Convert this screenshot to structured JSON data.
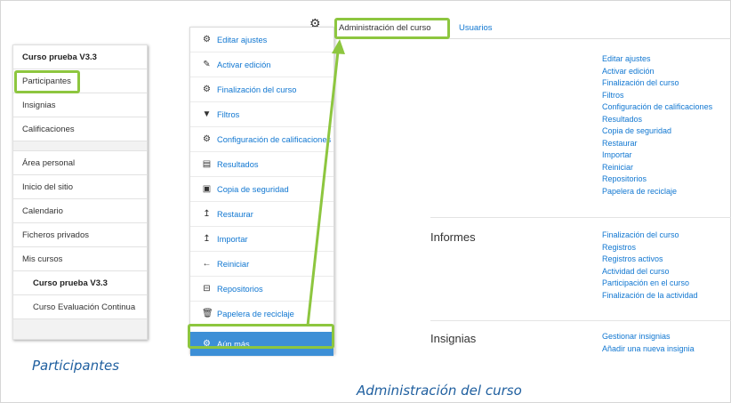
{
  "nav": {
    "items": [
      {
        "label": "Curso prueba V3.3",
        "style": "bold"
      },
      {
        "label": "Participantes",
        "style": "normal"
      },
      {
        "label": "Insignias",
        "style": "normal"
      },
      {
        "label": "Calificaciones",
        "style": "normal"
      },
      {
        "label": "Área personal",
        "style": "normal"
      },
      {
        "label": "Inicio del sitio",
        "style": "normal"
      },
      {
        "label": "Calendario",
        "style": "normal"
      },
      {
        "label": "Ficheros privados",
        "style": "normal"
      },
      {
        "label": "Mis cursos",
        "style": "normal"
      },
      {
        "label": "Curso prueba V3.3",
        "style": "bold-indent"
      },
      {
        "label": "Curso Evaluación Continua",
        "style": "indent"
      }
    ]
  },
  "actions_menu": {
    "gear_icon": "gear-icon",
    "items": [
      {
        "label": "Editar ajustes",
        "icon": "gear-icon",
        "glyph": "⚙"
      },
      {
        "label": "Activar edición",
        "icon": "pencil-icon",
        "glyph": "✎"
      },
      {
        "label": "Finalización del curso",
        "icon": "gear-icon",
        "glyph": "⚙"
      },
      {
        "label": "Filtros",
        "icon": "filter-icon",
        "glyph": "▼"
      },
      {
        "label": "Configuración de calificaciones",
        "icon": "gear-icon",
        "glyph": "⚙"
      },
      {
        "label": "Resultados",
        "icon": "table-icon",
        "glyph": "▤"
      },
      {
        "label": "Copia de seguridad",
        "icon": "file-icon",
        "glyph": "▣"
      },
      {
        "label": "Restaurar",
        "icon": "upload-icon",
        "glyph": "↥"
      },
      {
        "label": "Importar",
        "icon": "upload-icon",
        "glyph": "↥"
      },
      {
        "label": "Reiniciar",
        "icon": "arrow-left-icon",
        "glyph": "←"
      },
      {
        "label": "Repositorios",
        "icon": "drive-icon",
        "glyph": "⊟"
      },
      {
        "label": "Papelera de reciclaje",
        "icon": "trash-icon",
        "glyph": "🗑"
      },
      {
        "label": "Aún más...",
        "icon": "gear-icon",
        "glyph": "⚙"
      }
    ],
    "active_index": 12
  },
  "tabs": {
    "admin": "Administración del curso",
    "users": "Usuarios"
  },
  "main": {
    "course_links": [
      "Editar ajustes",
      "Activar edición",
      "Finalización del curso",
      "Filtros",
      "Configuración de calificaciones",
      "Resultados",
      "Copia de seguridad",
      "Restaurar",
      "Importar",
      "Reiniciar",
      "Repositorios",
      "Papelera de reciclaje"
    ],
    "reports": {
      "heading": "Informes",
      "links": [
        "Finalización del curso",
        "Registros",
        "Registros activos",
        "Actividad del curso",
        "Participación en el curso",
        "Finalización de la actividad"
      ]
    },
    "badges": {
      "heading": "Insignias",
      "links": [
        "Gestionar insignias",
        "Añadir una nueva insignia"
      ]
    }
  },
  "captions": {
    "left": "Participantes",
    "bottom": "Administración del curso"
  },
  "colors": {
    "highlight": "#8dc63f",
    "link": "#1177d1",
    "active_item": "#3d8fd6"
  }
}
